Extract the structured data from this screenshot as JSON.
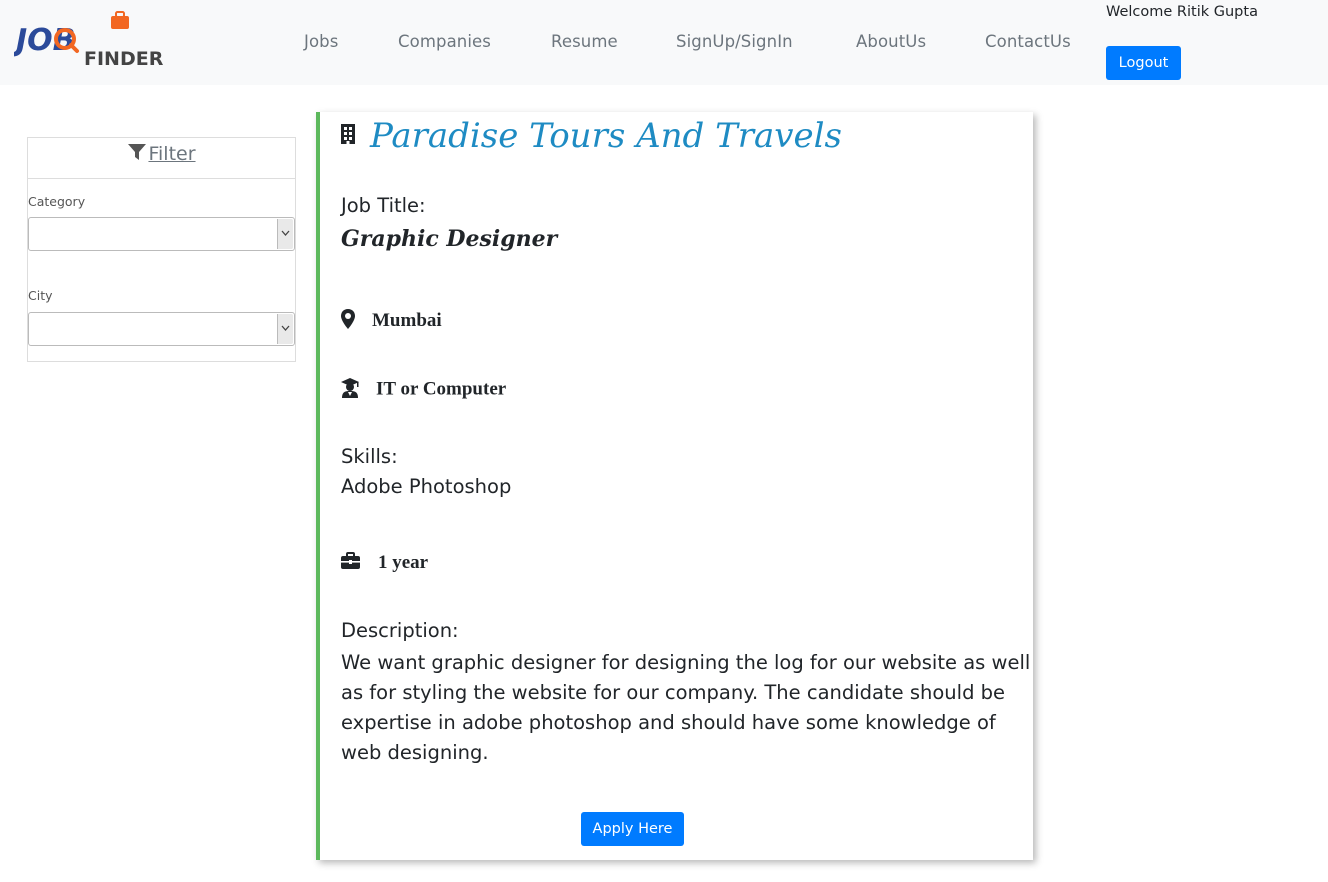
{
  "header": {
    "logo": {
      "text_top": "JOB",
      "text_bottom": "FINDER"
    },
    "nav": [
      {
        "label": "Jobs"
      },
      {
        "label": "Companies"
      },
      {
        "label": "Resume"
      },
      {
        "label": "SignUp/SignIn"
      },
      {
        "label": "AboutUs"
      },
      {
        "label": "ContactUs"
      }
    ],
    "welcome_text": "Welcome Ritik Gupta",
    "logout_label": "Logout"
  },
  "filter": {
    "title": "Filter",
    "icon": "filter-icon",
    "category_label": "Category",
    "category_value": "",
    "city_label": "City",
    "city_value": ""
  },
  "job": {
    "company_icon": "building-icon",
    "company": "Paradise Tours And Travels",
    "title_label": "Job Title:",
    "title": "Graphic Designer",
    "location_icon": "map-marker-icon",
    "location": "Mumbai",
    "category_icon": "graduate-icon",
    "category": "IT or Computer",
    "skills_label": "Skills:",
    "skills": "Adobe Photoshop",
    "experience_icon": "briefcase-icon",
    "experience": "1 year",
    "description_label": "Description:",
    "description": "We want graphic designer for designing the log for our website as well as for styling the website for our company. The candidate should be expertise in adobe photoshop and should have some knowledge of web designing.",
    "apply_label": "Apply Here"
  },
  "colors": {
    "accent": "#007bff",
    "company": "#1e8bc3",
    "card_border": "#5cb85c",
    "logo_blue": "#2b4a9a",
    "logo_orange": "#f26722",
    "header_bg": "#f8f9fa"
  }
}
